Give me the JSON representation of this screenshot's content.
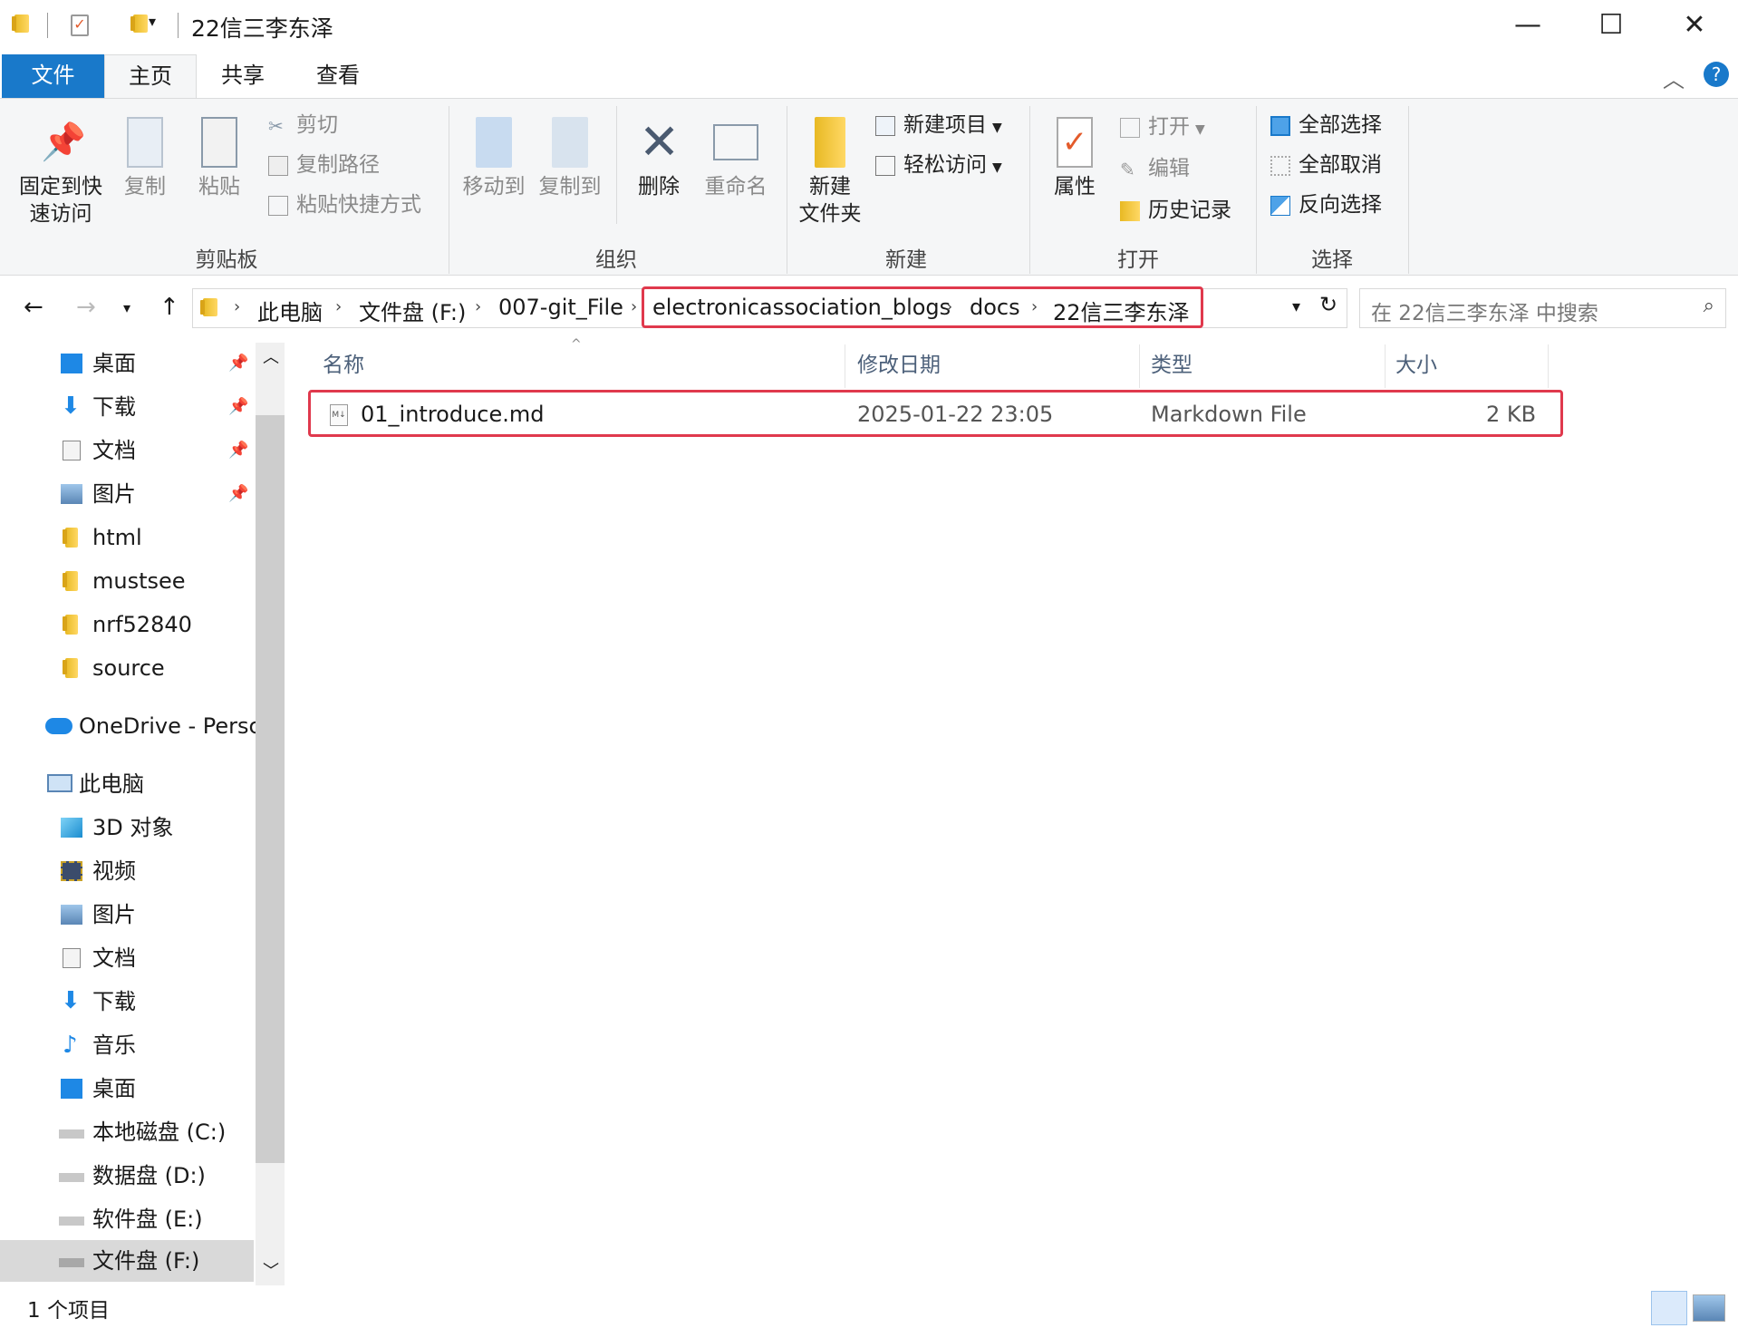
{
  "window": {
    "title": "22信三李东泽",
    "minimize": "—",
    "maximize": "☐",
    "close": "✕"
  },
  "tabs": {
    "file": "文件",
    "home": "主页",
    "share": "共享",
    "view": "查看"
  },
  "ribbon": {
    "clipboard": {
      "pin_line1": "固定到快",
      "pin_line2": "速访问",
      "copy": "复制",
      "paste": "粘贴",
      "cut": "剪切",
      "copy_path": "复制路径",
      "paste_shortcut": "粘贴快捷方式",
      "label": "剪贴板"
    },
    "organize": {
      "move_to": "移动到",
      "copy_to": "复制到",
      "delete": "删除",
      "rename": "重命名",
      "label": "组织"
    },
    "new": {
      "new_folder_line1": "新建",
      "new_folder_line2": "文件夹",
      "new_item": "新建项目",
      "easy_access": "轻松访问",
      "label": "新建"
    },
    "open": {
      "properties": "属性",
      "open": "打开",
      "edit": "编辑",
      "history": "历史记录",
      "label": "打开"
    },
    "select": {
      "select_all": "全部选择",
      "select_none": "全部取消",
      "invert": "反向选择",
      "label": "选择"
    }
  },
  "address": {
    "crumbs": [
      "此电脑",
      "文件盘 (F:)",
      "007-git_File",
      "electronicassociation_blogs",
      "docs",
      "22信三李东泽"
    ],
    "search_placeholder": "在 22信三李东泽 中搜索"
  },
  "nav": {
    "quick": [
      "桌面",
      "下载",
      "文档",
      "图片",
      "html",
      "mustsee",
      "nrf52840",
      "source"
    ],
    "onedrive": "OneDrive - Persc",
    "this_pc": "此电脑",
    "pc_items": [
      "3D 对象",
      "视频",
      "图片",
      "文档",
      "下载",
      "音乐",
      "桌面",
      "本地磁盘 (C:)",
      "数据盘 (D:)",
      "软件盘 (E:)",
      "文件盘 (F:)"
    ]
  },
  "columns": {
    "name": "名称",
    "date": "修改日期",
    "type": "类型",
    "size": "大小"
  },
  "files": [
    {
      "name": "01_introduce.md",
      "date": "2025-01-22 23:05",
      "type": "Markdown File",
      "size": "2 KB"
    }
  ],
  "status": {
    "count": "1 个项目"
  },
  "colors": {
    "accent": "#1979ca",
    "highlight": "#e0394d"
  }
}
